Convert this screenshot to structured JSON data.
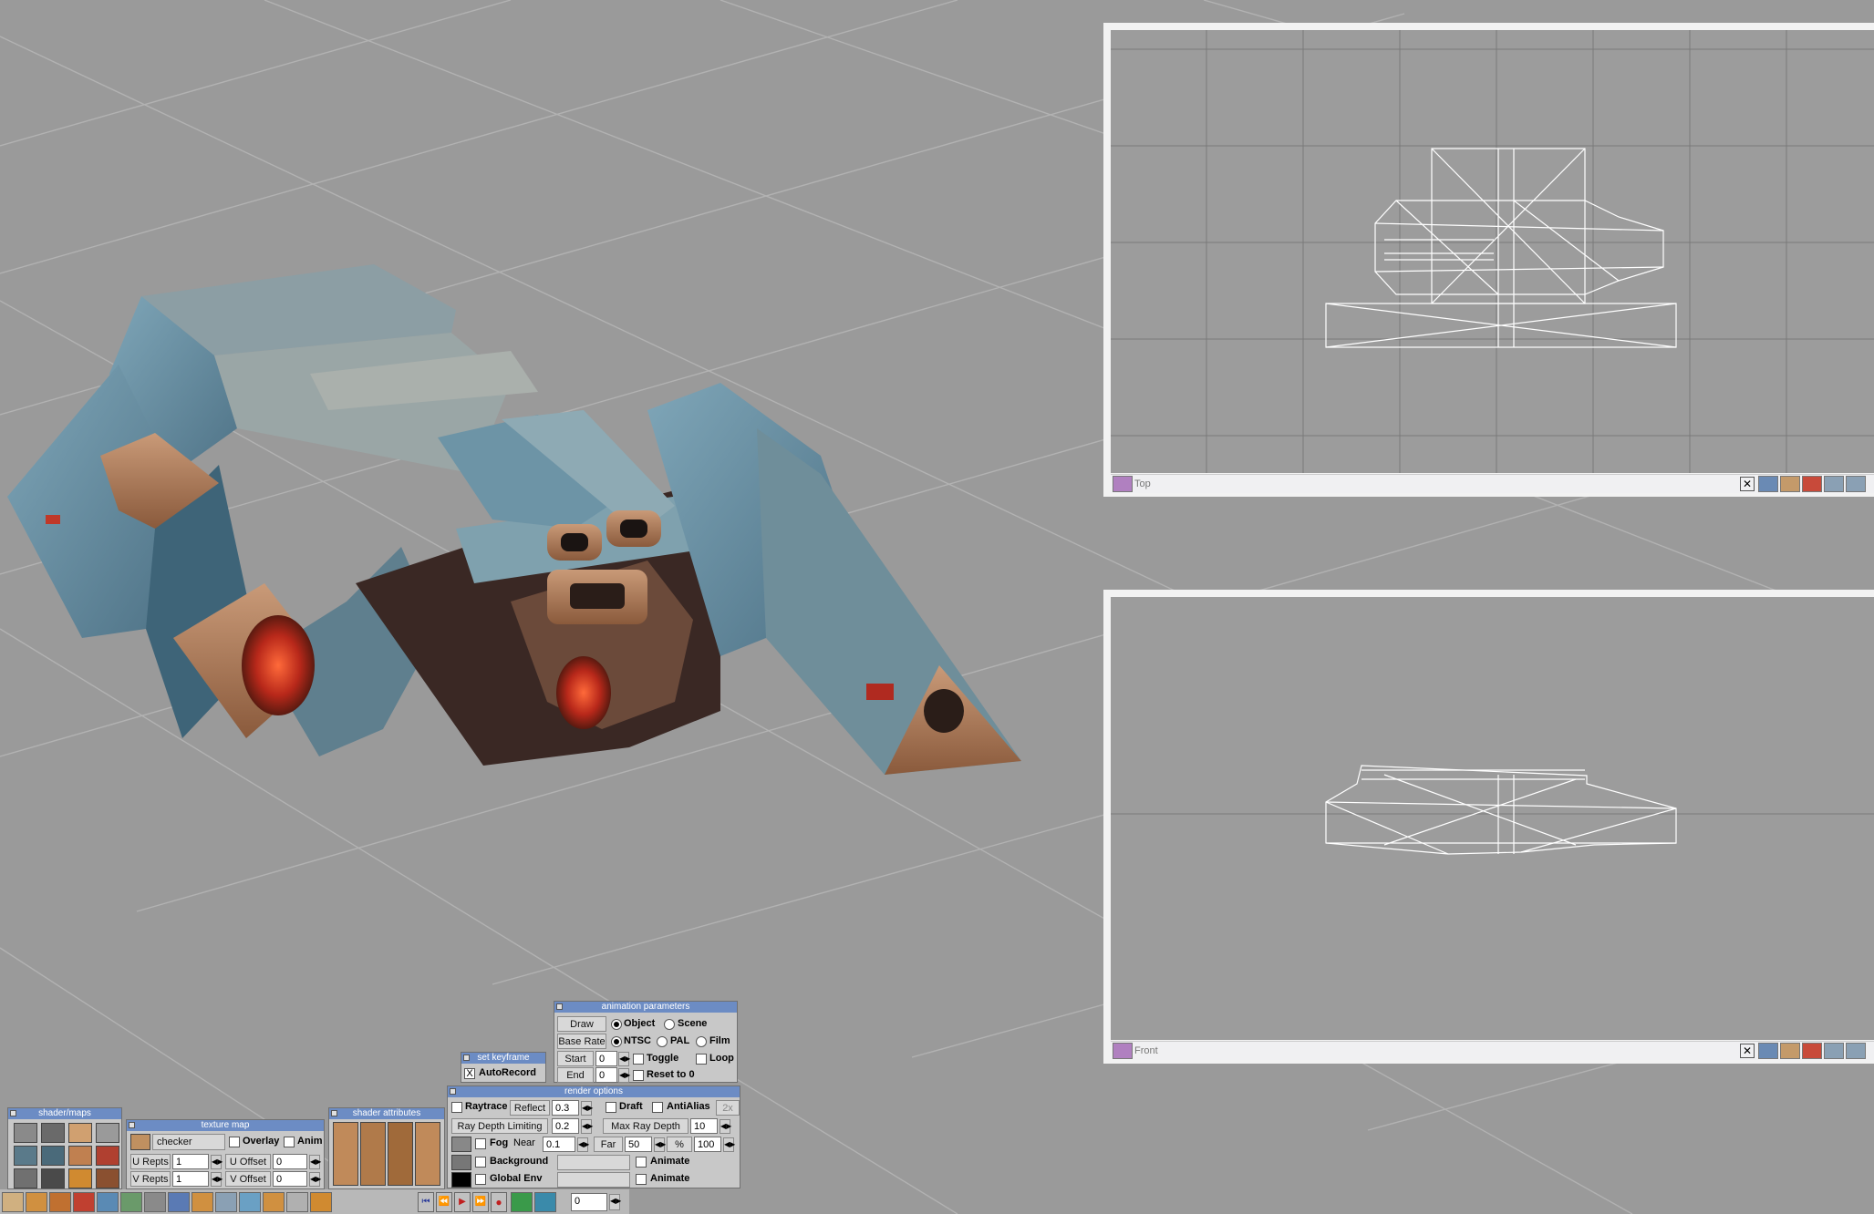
{
  "viewports": {
    "top": {
      "label": "Top"
    },
    "front": {
      "label": "Front"
    }
  },
  "icons": [
    "close-icon",
    "viewport-mode-icon",
    "shader-swatch-icon",
    "play-icon",
    "rewind-icon",
    "record-icon"
  ],
  "colors": {
    "background": "#9a9a9a",
    "panel": "#c8c8c8",
    "title_bar": "#6c8cc4",
    "wireframe": "#ffffff",
    "viewport_frame": "#f2f2f2"
  },
  "animation_parameters": {
    "title": "animation parameters",
    "draw_label": "Draw",
    "object_label": "Object",
    "scene_label": "Scene",
    "base_rate_label": "Base Rate",
    "ntsc_label": "NTSC",
    "pal_label": "PAL",
    "film_label": "Film",
    "start_label": "Start",
    "start_value": "0",
    "end_label": "End",
    "end_value": "0",
    "toggle_label": "Toggle",
    "loop_label": "Loop",
    "reset_label": "Reset to 0"
  },
  "set_keyframe": {
    "title": "set keyframe",
    "autorecord_label": "AutoRecord",
    "autorecord_mark": "X"
  },
  "render_options": {
    "title": "render options",
    "raytrace_label": "Raytrace",
    "reflect_label": "Reflect",
    "reflect_value": "0.3",
    "draft_label": "Draft",
    "antialias_label": "AntiAlias",
    "aa_value": "2x",
    "ray_depth_limiting_label": "Ray Depth Limiting",
    "ray_depth_limiting_value": "0.2",
    "max_ray_depth_label": "Max Ray Depth",
    "max_ray_depth_value": "10",
    "fog_label": "Fog",
    "near_label": "Near",
    "near_value": "0.1",
    "far_label": "Far",
    "far_value": "50",
    "percent_label": "%",
    "percent_value": "100",
    "background_label": "Background",
    "global_env_label": "Global Env",
    "animate_label": "Animate"
  },
  "texture_map": {
    "title": "texture map",
    "texture_name": "checker",
    "overlay_label": "Overlay",
    "anim_label": "Anim",
    "u_repts_label": "U Repts",
    "u_repts_value": "1",
    "v_repts_label": "V Repts",
    "v_repts_value": "1",
    "u_offset_label": "U Offset",
    "u_offset_value": "0",
    "v_offset_label": "V Offset",
    "v_offset_value": "0"
  },
  "shader_maps": {
    "title": "shader/maps"
  },
  "shader_attributes": {
    "title": "shader attributes"
  },
  "toolbar": {
    "frame_value": "0"
  }
}
